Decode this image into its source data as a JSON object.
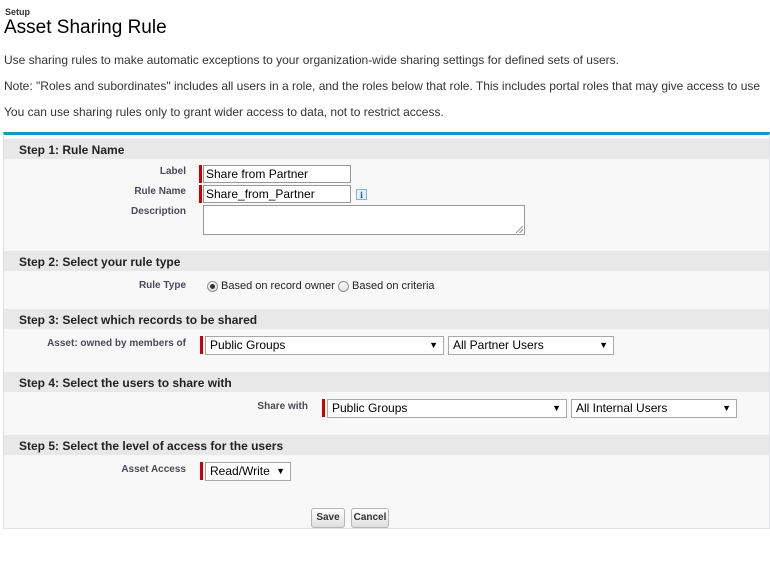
{
  "header": {
    "setup": "Setup",
    "title": "Asset Sharing Rule"
  },
  "intro": {
    "line1": "Use sharing rules to make automatic exceptions to your organization-wide sharing settings for defined sets of users.",
    "line2": "Note: \"Roles and subordinates\" includes all users in a role, and the roles below that role. This includes portal roles that may give access to use",
    "line3": "You can use sharing rules only to grant wider access to data, not to restrict access."
  },
  "step1": {
    "header": "Step 1: Rule Name",
    "label_label": "Label",
    "label_value": "Share from Partner",
    "rule_name_label": "Rule Name",
    "rule_name_value": "Share_from_Partner",
    "info_icon": "i",
    "description_label": "Description",
    "description_value": ""
  },
  "step2": {
    "header": "Step 2: Select your rule type",
    "rule_type_label": "Rule Type",
    "option_owner": "Based on record owner",
    "option_criteria": "Based on criteria",
    "selected": "owner"
  },
  "step3": {
    "header": "Step 3: Select which records to be shared",
    "owned_label": "Asset: owned by members of",
    "group_type": "Public Groups",
    "group_value": "All Partner Users"
  },
  "step4": {
    "header": "Step 4: Select the users to share with",
    "share_with_label": "Share with",
    "group_type": "Public Groups",
    "group_value": "All Internal Users"
  },
  "step5": {
    "header": "Step 5: Select the level of access for the users",
    "access_label": "Asset Access",
    "access_value": "Read/Write"
  },
  "buttons": {
    "save": "Save",
    "cancel": "Cancel"
  },
  "icons": {
    "dropdown_arrow": "▼"
  },
  "colors": {
    "accent": "#1797c0",
    "required": "#cc0000",
    "section_header": "#e8e8e9"
  }
}
